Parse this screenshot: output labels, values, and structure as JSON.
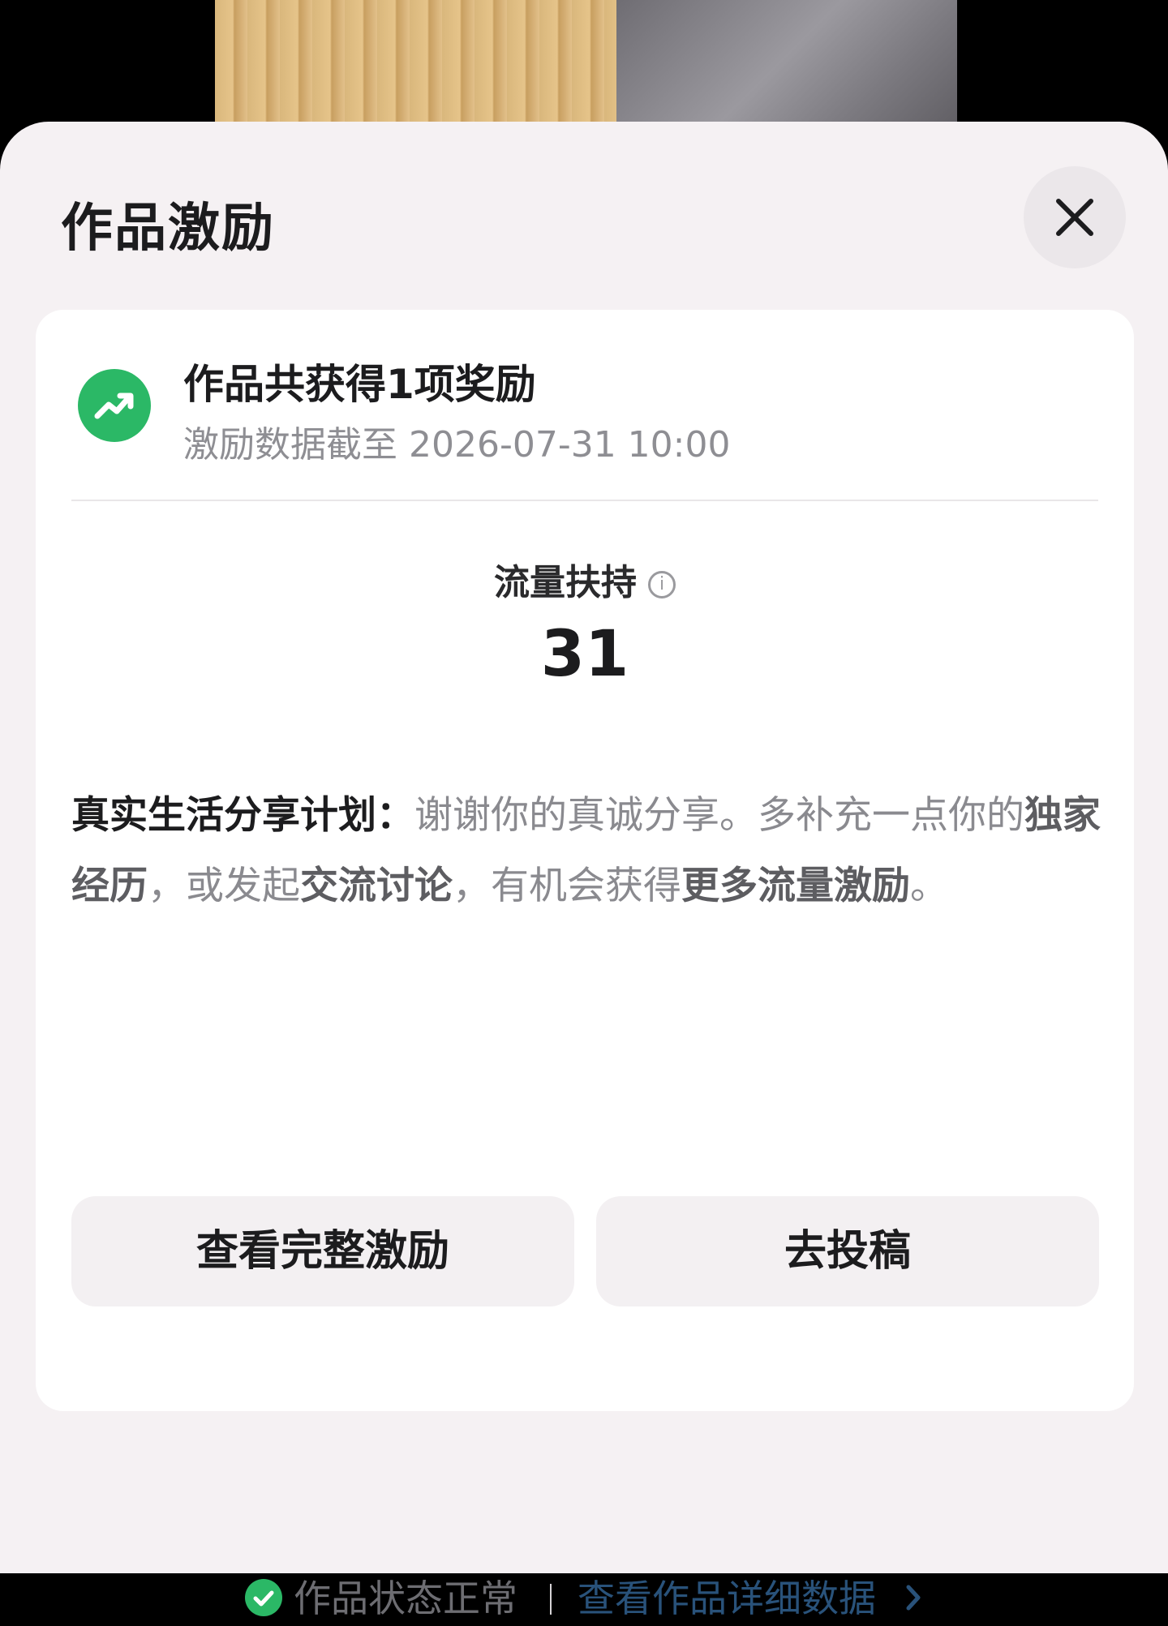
{
  "sheet": {
    "title": "作品激励"
  },
  "summary": {
    "title": "作品共获得1项奖励",
    "subtitle": "激励数据截至 2026-07-31 10:00"
  },
  "metric": {
    "label": "流量扶持",
    "value": "31"
  },
  "description": {
    "program": "真实生活分享计划：",
    "p1": "谢谢你的真诚分享。多补充一点你的",
    "h1": "独家经历",
    "p2": "，或发起",
    "h2": "交流讨论",
    "p3": "，有机会获得",
    "h3": "更多流量激励",
    "p4": "。"
  },
  "buttons": {
    "full_incentive": "查看完整激励",
    "submit": "去投稿"
  },
  "footer": {
    "status": "作品状态正常",
    "details_link": "查看作品详细数据"
  },
  "colors": {
    "accent_green": "#2bb866",
    "link_blue": "#29527a"
  }
}
